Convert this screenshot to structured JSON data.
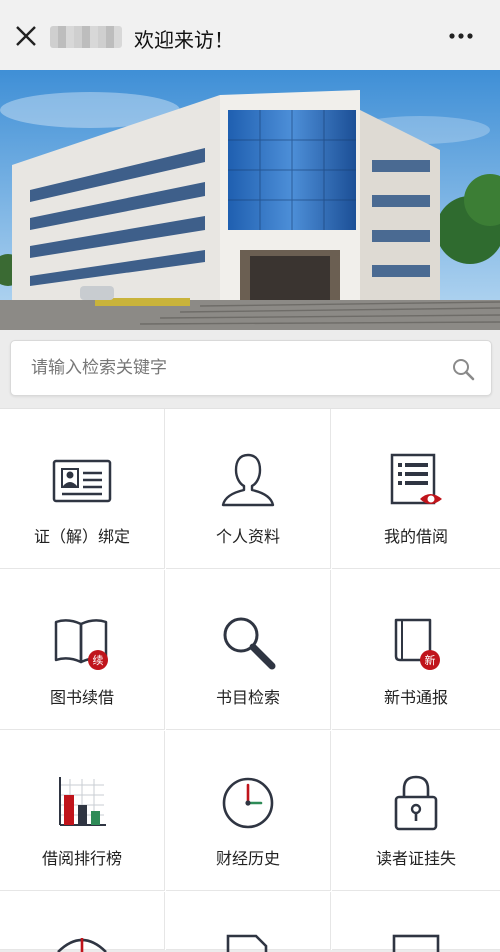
{
  "header": {
    "title": "欢迎来访！",
    "close_icon": "close-icon",
    "more_icon": "more-icon"
  },
  "search": {
    "placeholder": "请输入检索关键字",
    "value": ""
  },
  "menu": [
    {
      "label": "证（解）绑定",
      "icon": "id-card-icon"
    },
    {
      "label": "个人资料",
      "icon": "person-icon"
    },
    {
      "label": "我的借阅",
      "icon": "list-view-icon"
    },
    {
      "label": "图书续借",
      "icon": "book-renew-icon",
      "badge": "续"
    },
    {
      "label": "书目检索",
      "icon": "magnifier-icon"
    },
    {
      "label": "新书通报",
      "icon": "new-book-icon",
      "badge": "新"
    },
    {
      "label": "借阅排行榜",
      "icon": "bar-chart-icon"
    },
    {
      "label": "财经历史",
      "icon": "clock-icon"
    },
    {
      "label": "读者证挂失",
      "icon": "lock-icon"
    }
  ],
  "colors": {
    "accent": "#c0141b",
    "icon_stroke": "#2f3542"
  }
}
